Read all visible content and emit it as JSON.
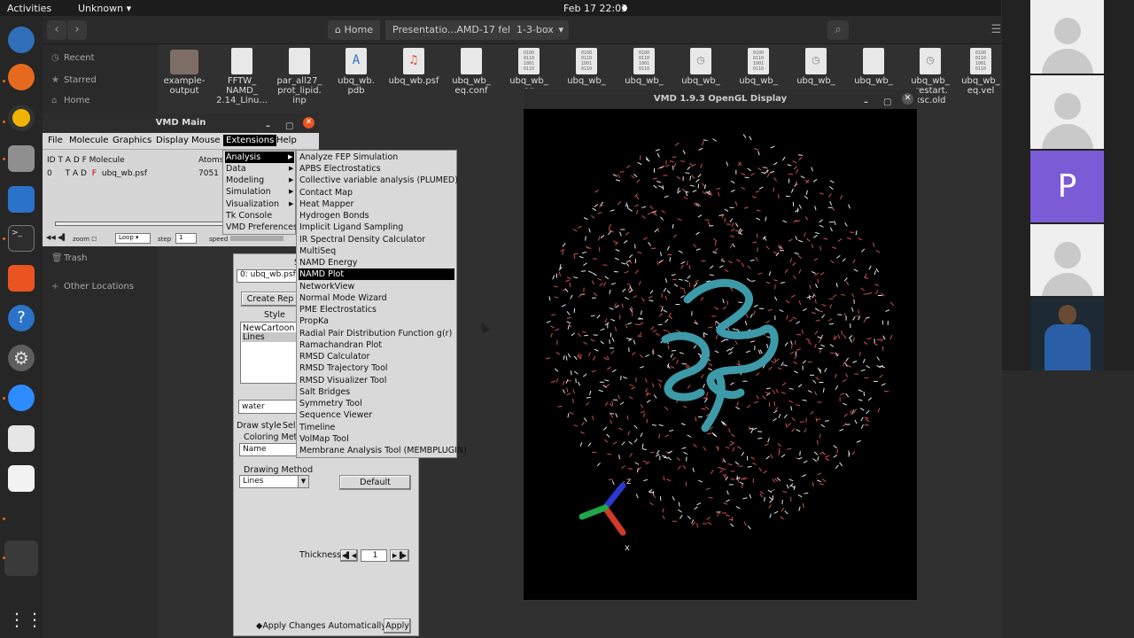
{
  "topbar": {
    "activities": "Activities",
    "app": "Unknown",
    "clock": "Feb 17  22:03"
  },
  "dock": {
    "icons": [
      "thunderbird-icon",
      "firefox-icon",
      "rhythmbox-icon",
      "files-icon",
      "writer-icon",
      "terminal-icon",
      "software-icon",
      "help-icon",
      "settings-icon",
      "zoom-icon",
      "viewer-icon",
      "editor-icon",
      "blank-icon",
      "apps-grid-icon"
    ]
  },
  "filemanager": {
    "breadcrumbs": [
      "Home",
      "Presentatio...AMD-17 feb",
      "1-3-box"
    ],
    "sidebar": [
      "Recent",
      "Starred",
      "Home",
      "Trash",
      "Other Locations"
    ],
    "files": [
      {
        "name": "example-\noutput"
      },
      {
        "name": "FFTW_\nNAMD_\n2.14_Linu..."
      },
      {
        "name": "par_all27_\nprot_lipid.\ninp"
      },
      {
        "name": "ubq_wb.\npdb"
      },
      {
        "name": "ubq_wb.psf"
      },
      {
        "name": "ubq_wb_\neq.conf"
      },
      {
        "name": "ubq_wb_\neq"
      },
      {
        "name": "ubq_wb_"
      },
      {
        "name": "ubq_wb_"
      },
      {
        "name": "ubq_wb_"
      },
      {
        "name": "ubq_wb_"
      },
      {
        "name": "ubq_wb_"
      },
      {
        "name": "ubq_wb_"
      },
      {
        "name": "ubq_wb_\n.restart.\nxsc.old"
      },
      {
        "name": "ubq_wb_\neq.vel"
      }
    ]
  },
  "vmd_main": {
    "title": "VMD Main",
    "menus": [
      "File",
      "Molecule",
      "Graphics",
      "Display",
      "Mouse",
      "Extensions",
      "Help"
    ],
    "columns": "ID   T  A  D  F  Molecule",
    "atoms_label": "Atoms",
    "row": {
      "id": "0",
      "flags": "T  A  D",
      "f": "F",
      "molecule": "ubq_wb.psf",
      "atoms": "7051"
    },
    "zoom": "zoom",
    "loop": "Loop",
    "step": "step",
    "step_val": "1",
    "speed": "speed"
  },
  "extensions_menu": {
    "items": [
      "Analysis",
      "Data",
      "Modeling",
      "Simulation",
      "Visualization",
      "Tk Console",
      "VMD Preferences"
    ],
    "selected": "Analysis"
  },
  "analysis_submenu": {
    "items": [
      "Analyze FEP Simulation",
      "APBS Electrostatics",
      "Collective variable analysis (PLUMED)",
      "Contact Map",
      "Heat Mapper",
      "Hydrogen Bonds",
      "Implicit Ligand Sampling",
      "IR Spectral Density Calculator",
      "MultiSeq",
      "NAMD Energy",
      "NAMD Plot",
      "NetworkView",
      "Normal Mode Wizard",
      "PME Electrostatics",
      "PropKa",
      "Radial Pair Distribution Function g(r)",
      "Ramachandran Plot",
      "RMSD Calculator",
      "RMSD Trajectory Tool",
      "RMSD Visualizer Tool",
      "Salt Bridges",
      "Symmetry Tool",
      "Sequence Viewer",
      "Timeline",
      "VolMap Tool",
      "Membrane Analysis Tool (MEMBPLUGIN)"
    ],
    "highlighted": "NAMD Plot"
  },
  "reps": {
    "title_frag": "S",
    "molecule_select": "0: ubq_wb.psf",
    "create_rep": "Create Rep",
    "style_label": "Style",
    "styles": [
      "NewCartoon",
      "Lines"
    ],
    "selection": "water",
    "tab_draw": "Draw style",
    "tab_sel": "Sele",
    "coloring_label": "Coloring Meth",
    "coloring_value": "Name",
    "drawing_label": "Drawing Method",
    "drawing_value": "Lines",
    "default_btn": "Default",
    "thickness_label": "Thickness",
    "thickness_value": "1",
    "apply_auto": "Apply Changes Automatically",
    "apply": "Apply"
  },
  "gl_display": {
    "title": "VMD 1.9.3 OpenGL Display",
    "axis_z": "z",
    "axis_x": "x"
  },
  "meeting": {
    "participant_initial": "P"
  }
}
